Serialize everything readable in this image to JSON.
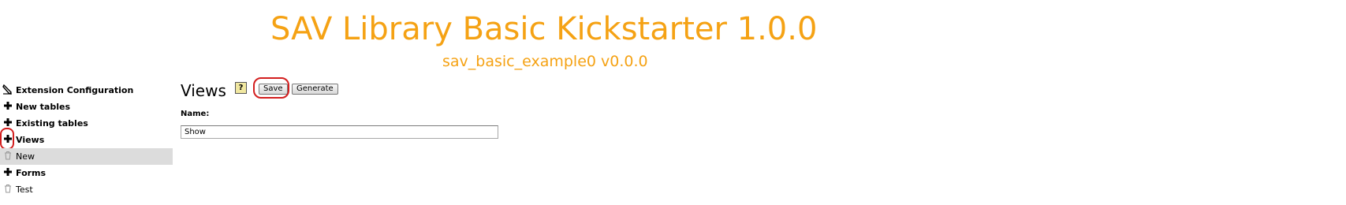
{
  "header": {
    "title": "SAV Library Basic Kickstarter 1.0.0",
    "subtitle": "sav_basic_example0 v0.0.0",
    "accent_color": "#f5a214"
  },
  "sidebar": {
    "items": [
      {
        "label": "Extension Configuration",
        "icon": "pencil-icon"
      },
      {
        "label": "New tables",
        "icon": "plus-icon"
      },
      {
        "label": "Existing tables",
        "icon": "plus-icon"
      },
      {
        "label": "Views",
        "icon": "plus-icon"
      },
      {
        "label": "New",
        "icon": "trash-icon",
        "selected": true
      },
      {
        "label": "Forms",
        "icon": "plus-icon"
      },
      {
        "label": "Test",
        "icon": "trash-icon"
      }
    ]
  },
  "main": {
    "heading": "Views",
    "help_icon": "help-icon",
    "save_label": "Save",
    "generate_label": "Generate",
    "name_label": "Name:",
    "name_value": "Show"
  },
  "highlight_color": "#d31f1f"
}
